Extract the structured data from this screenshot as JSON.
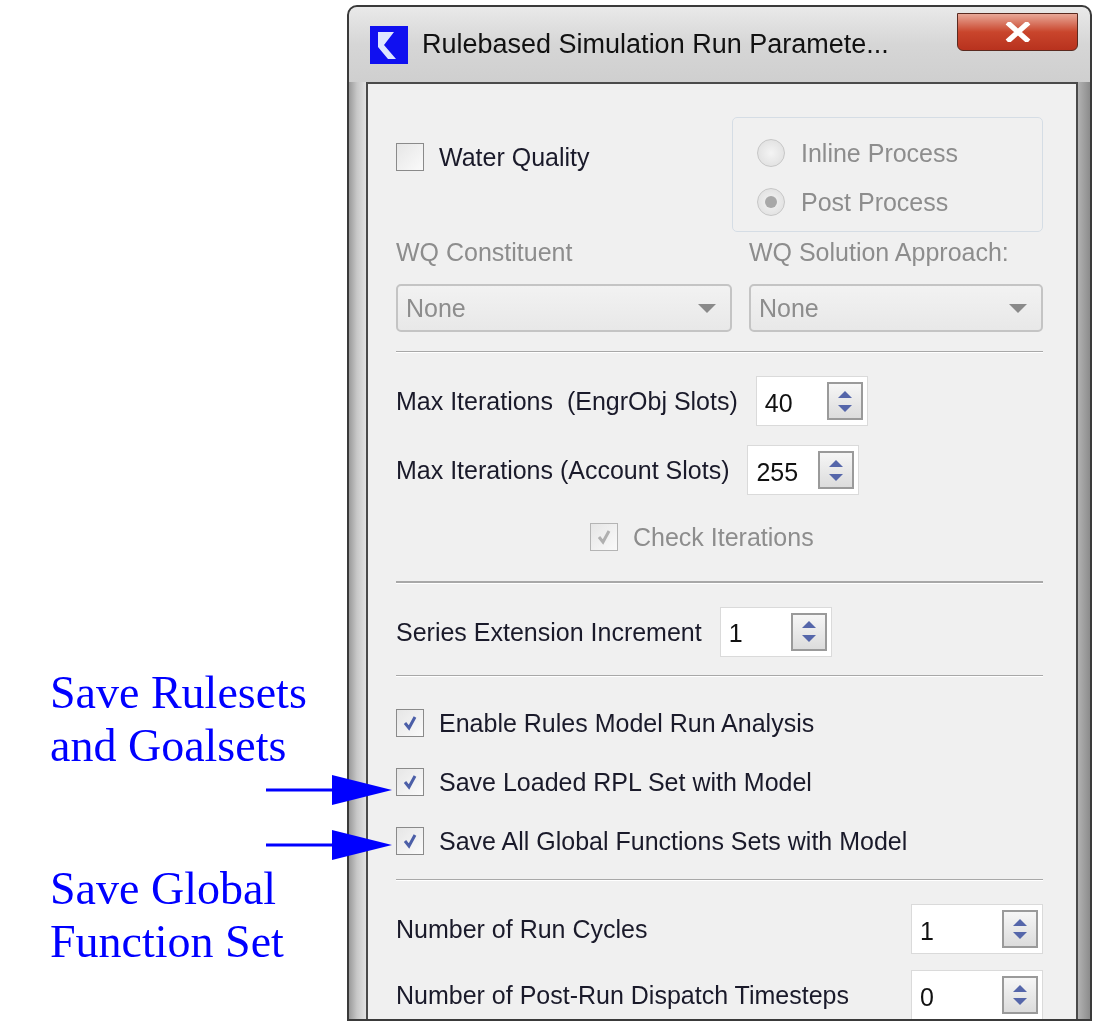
{
  "window": {
    "title": "Rulebased Simulation Run Paramete..."
  },
  "water_quality": {
    "label": "Water Quality",
    "checked": false
  },
  "process_options": [
    {
      "label": "Inline Process",
      "selected": false,
      "disabled": true
    },
    {
      "label": "Post Process",
      "selected": true,
      "disabled": true
    }
  ],
  "dropdowns": [
    {
      "label": "WQ Constituent",
      "value": "None",
      "disabled": true
    },
    {
      "label": "WQ Solution Approach:",
      "value": "None",
      "disabled": true
    }
  ],
  "iteration_fields": [
    {
      "label": "Max Iterations  (EngrObj Slots)",
      "value": "40"
    },
    {
      "label": "Max Iterations (Account Slots)",
      "value": "255"
    }
  ],
  "check_iterations": {
    "label": "Check Iterations",
    "checked": true,
    "disabled": true
  },
  "series_extension": {
    "label": "Series Extension Increment",
    "value": "1"
  },
  "rule_options": [
    {
      "label": "Enable Rules Model Run Analysis",
      "checked": true
    },
    {
      "label": "Save Loaded RPL Set with Model",
      "checked": true
    },
    {
      "label": "Save All Global Functions Sets with Model",
      "checked": true
    }
  ],
  "run_fields": [
    {
      "label": "Number of Run Cycles",
      "value": "1"
    },
    {
      "label": "Number of Post-Run Dispatch Timesteps",
      "value": "0"
    }
  ],
  "annotations": [
    {
      "text": "Save Rulesets\nand Goalsets",
      "arrow": true
    },
    {
      "text": "Save Global\nFunction Set",
      "arrow": true
    }
  ]
}
